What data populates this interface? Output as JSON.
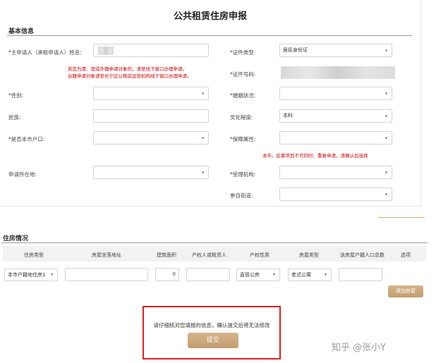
{
  "page": {
    "title": "公共租赁住房申报"
  },
  "basic_info": {
    "section_title": "基本信息",
    "applicant_name_label": "*主申请人（承租申请人）姓名:",
    "id_type_label": "*证件类型:",
    "id_type_value": "居民身份证",
    "id_number_label": "*证件号码:",
    "warning_1a": "若您为港、澳或外籍申请对象的，请至线下窗口办理申请。",
    "warning_1b": "台籍申请对象请至长宁区公租房运营机构线下窗口办理申请。",
    "gender_label": "*性别:",
    "marital_label": "*婚姻状况:",
    "ethnicity_label": "民族:",
    "education_label": "文化程度:",
    "education_value": "本科",
    "hukou_label": "*是否本市户口:",
    "guarantee_label": "*保障属性:",
    "warning_2": "本市、区筹项目不可同时、重复申请，请确认后选择",
    "district_label": "申请所在地:",
    "agency_label": "*受理机构:",
    "street_label": "参自街道:"
  },
  "housing": {
    "section_title": "住房情况",
    "columns": [
      "住房类型",
      "房屋坐落地址",
      "建筑面积",
      "产权人或租赁人",
      "产权性质",
      "房屋类型",
      "该房屋户籍人口总数",
      "选项"
    ],
    "row": {
      "housing_type": "本市户籍地住房1",
      "area": "0",
      "property_nature": "直管公房",
      "house_type": "老式公寓"
    },
    "add_button": "添加房屋"
  },
  "submit": {
    "notice": "请仔细核对您填报的信息，确认提交后将无法修改",
    "button": "提交"
  },
  "watermark": "知乎 @张小Y"
}
